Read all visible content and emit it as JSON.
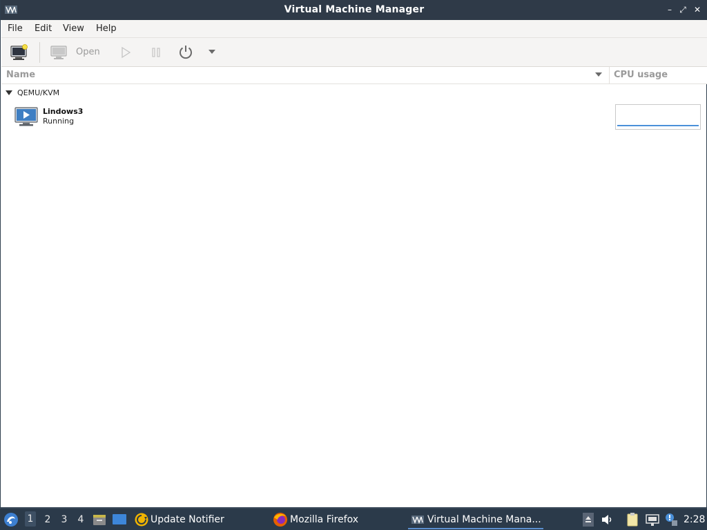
{
  "window": {
    "title": "Virtual Machine Manager",
    "controls": {
      "minimize": "–",
      "maximize": "⤢",
      "close": "✕"
    }
  },
  "menu": {
    "file": "File",
    "edit": "Edit",
    "view": "View",
    "help": "Help"
  },
  "toolbar": {
    "new_vm_icon": "new-vm-icon",
    "open_label": "Open",
    "run_icon": "play-icon",
    "pause_icon": "pause-icon",
    "shutdown_icon": "power-icon",
    "shutdown_menu_icon": "chevron-down-icon"
  },
  "columns": {
    "name": "Name",
    "cpu": "CPU usage"
  },
  "connection": {
    "label": "QEMU/KVM"
  },
  "vms": [
    {
      "name": "Lindows3",
      "status": "Running",
      "cpu_usage_fraction": 0.02
    }
  ],
  "taskbar": {
    "workspaces": [
      "1",
      "2",
      "3",
      "4"
    ],
    "active_workspace": "1",
    "tasks": [
      "Update Notifier",
      "Mozilla Firefox",
      "Virtual Machine Mana..."
    ],
    "clock": "2:28"
  },
  "colors": {
    "titlebar": "#2f3a48",
    "taskbar": "#2b3a4a",
    "accent": "#4a90d9"
  }
}
